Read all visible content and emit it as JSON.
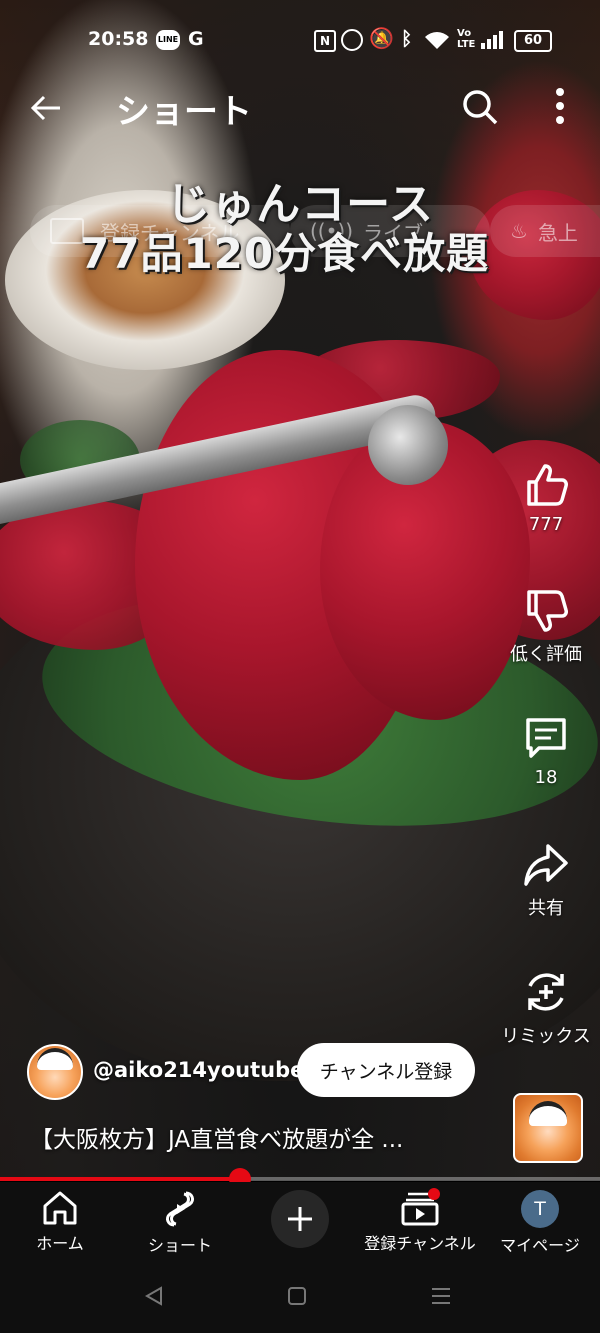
{
  "status_bar": {
    "time": "20:58",
    "notification_icons": [
      "line-icon",
      "google-icon"
    ],
    "system_icons": [
      "nfc-icon",
      "alarm-icon",
      "mute-icon",
      "bluetooth-icon",
      "wifi-icon",
      "volte-icon",
      "signal-icon"
    ],
    "battery": "60"
  },
  "header": {
    "title": "ショート",
    "back_icon": "arrow-left-icon",
    "search_icon": "search-icon",
    "menu_icon": "more-vertical-icon"
  },
  "video": {
    "overlay_line1": "じゅんコース",
    "overlay_line2": "77品120分食べ放題",
    "background_chips": [
      "登録チャンネル",
      "ライブ",
      "急上"
    ]
  },
  "actions": {
    "like": {
      "icon": "thumb-up-icon",
      "label": "777"
    },
    "dislike": {
      "icon": "thumb-down-icon",
      "label": "低く評価"
    },
    "comments": {
      "icon": "comment-icon",
      "label": "18"
    },
    "share": {
      "icon": "share-icon",
      "label": "共有"
    },
    "remix": {
      "icon": "remix-icon",
      "label": "リミックス"
    }
  },
  "channel": {
    "handle": "@aiko214youtube",
    "subscribe_label": "チャンネル登録",
    "video_title": "【大阪枚方】JA直営食べ放題が全 ..."
  },
  "progress": {
    "fraction": 0.4,
    "color": "#e50914"
  },
  "nav": {
    "items": [
      {
        "icon": "home-icon",
        "label": "ホーム"
      },
      {
        "icon": "shorts-icon",
        "label": "ショート"
      },
      {
        "icon": "create-plus-icon",
        "label": ""
      },
      {
        "icon": "subscriptions-icon",
        "label": "登録チャンネル"
      },
      {
        "icon": "avatar-icon",
        "label": "マイページ",
        "avatar_letter": "T"
      }
    ]
  },
  "system_nav": [
    "back-triangle-icon",
    "home-square-icon",
    "recents-lines-icon"
  ],
  "colors": {
    "accent_red": "#e50914",
    "nav_bg": "#0f0f0f",
    "avatar_bg": "#4a6b8a"
  }
}
